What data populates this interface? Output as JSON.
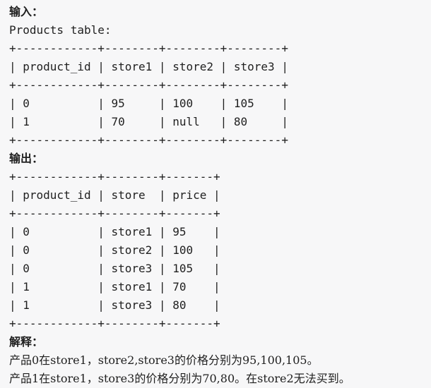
{
  "input_section": {
    "heading": "输入：",
    "caption": "Products table:",
    "table_lines": [
      "+------------+--------+--------+--------+",
      "| product_id | store1 | store2 | store3 |",
      "+------------+--------+--------+--------+",
      "| 0          | 95     | 100    | 105    |",
      "| 1          | 70     | null   | 80     |",
      "+------------+--------+--------+--------+"
    ]
  },
  "output_section": {
    "heading": "输出：",
    "table_lines": [
      "+------------+--------+-------+",
      "| product_id | store  | price |",
      "+------------+--------+-------+",
      "| 0          | store1 | 95    |",
      "| 0          | store2 | 100   |",
      "| 0          | store3 | 105   |",
      "| 1          | store1 | 70    |",
      "| 1          | store3 | 80    |",
      "+------------+--------+-------+"
    ]
  },
  "explanation_section": {
    "heading": "解释：",
    "line1": "产品0在store1，store2,store3的价格分别为95,100,105。",
    "line2": "产品1在store1，store3的价格分别为70,80。在store2无法买到。"
  }
}
